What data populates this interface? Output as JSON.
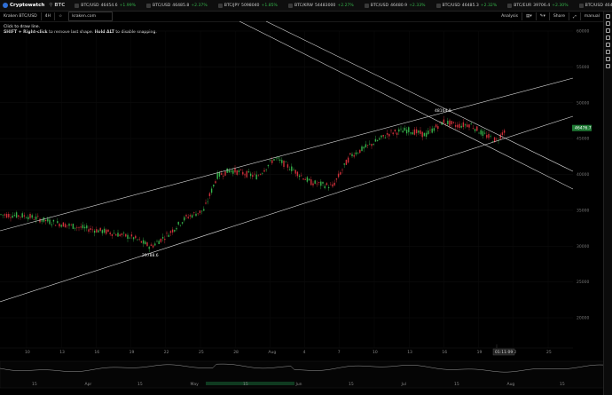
{
  "app": {
    "name": "Cryptowatch",
    "search_label": "BTC"
  },
  "ticker": [
    {
      "pair": "BTC/USD",
      "price": "46454.6",
      "change": "+1.99%",
      "dir": "up"
    },
    {
      "pair": "BTC/USD",
      "price": "46485.8",
      "change": "+2.37%",
      "dir": "up"
    },
    {
      "pair": "BTC/JPY",
      "price": "5098040",
      "change": "+1.85%",
      "dir": "up"
    },
    {
      "pair": "BTC/KRW",
      "price": "54483000",
      "change": "+2.27%",
      "dir": "up"
    },
    {
      "pair": "BTC/USD",
      "price": "46480.9",
      "change": "+2.33%",
      "dir": "up"
    },
    {
      "pair": "BTC/USD",
      "price": "46485.3",
      "change": "+2.32%",
      "dir": "up"
    },
    {
      "pair": "BTC/EUR",
      "price": "39706.4",
      "change": "+2.30%",
      "dir": "up"
    },
    {
      "pair": "BTC/USD",
      "price": "46476.7",
      "change": "+1.99%",
      "dir": "up"
    },
    {
      "pair": "BTC/USD",
      "price": "46481.8",
      "change": "+2.37%",
      "dir": "up"
    },
    {
      "pair": "ETH",
      "price": "",
      "change": "",
      "dir": "up"
    }
  ],
  "toolbar": {
    "market": "Kraken BTC/USD",
    "interval": "4H",
    "url": "kraken.com",
    "analysis": "Analysis",
    "share": "Share",
    "mode": "manual"
  },
  "hint": {
    "line1": "Click to draw line.",
    "line2_a": "SHIFT + Right-click",
    "line2_b": " to remove last shape. ",
    "line2_c": "Hold ALT",
    "line2_d": " to disable snapping."
  },
  "price_axis": {
    "ticks": [
      "60000",
      "55000",
      "50000",
      "45000",
      "40000",
      "35000",
      "30000",
      "25000",
      "20000"
    ],
    "current_price": "46476.7",
    "current_color": "#1f7a35"
  },
  "date_axis": {
    "ticks": [
      "10",
      "13",
      "16",
      "19",
      "22",
      "25",
      "28",
      "Aug",
      "4",
      "7",
      "10",
      "13",
      "16",
      "19",
      "22",
      "25"
    ],
    "cursor_time": "01:11:09"
  },
  "annotations": {
    "high_label": "48164.9",
    "low_label": "29788.6"
  },
  "overview_axis": {
    "ticks": [
      "15",
      "Apr",
      "15",
      "May",
      "15",
      "Jun",
      "15",
      "Jul",
      "15",
      "Aug",
      "15"
    ]
  },
  "colors": {
    "up": "#35b24a",
    "down": "#d0303a",
    "line": "#d8d8d8"
  }
}
